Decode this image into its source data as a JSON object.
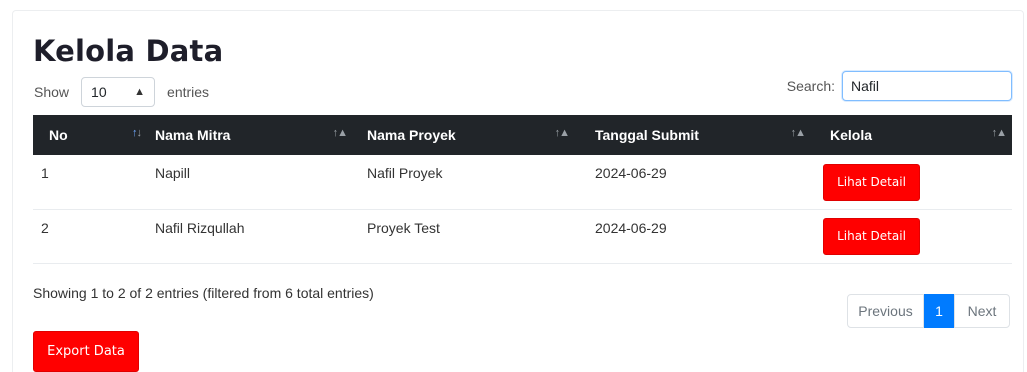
{
  "page": {
    "title": "Kelola Data"
  },
  "length_menu": {
    "show_label": "Show",
    "value": "10",
    "entries_label": "entries"
  },
  "search": {
    "label": "Search:",
    "value": "Nafil"
  },
  "table": {
    "columns": [
      {
        "label": "No",
        "sort": "asc"
      },
      {
        "label": "Nama Mitra",
        "sort": "none"
      },
      {
        "label": "Nama Proyek",
        "sort": "none"
      },
      {
        "label": "Tanggal Submit",
        "sort": "none"
      },
      {
        "label": "Kelola",
        "sort": "none"
      }
    ],
    "rows": [
      {
        "no": "1",
        "nama_mitra": "Napill",
        "nama_proyek": "Nafil Proyek",
        "tanggal": "2024-06-29",
        "action": "Lihat Detail"
      },
      {
        "no": "2",
        "nama_mitra": "Nafil Rizqullah",
        "nama_proyek": "Proyek Test",
        "tanggal": "2024-06-29",
        "action": "Lihat Detail"
      }
    ]
  },
  "info": "Showing 1 to 2 of 2 entries (filtered from 6 total entries)",
  "pagination": {
    "previous": "Previous",
    "current": "1",
    "next": "Next"
  },
  "export_button": "Export Data",
  "colors": {
    "header_bg": "#212529",
    "danger": "#ff0000",
    "primary": "#007bff"
  }
}
